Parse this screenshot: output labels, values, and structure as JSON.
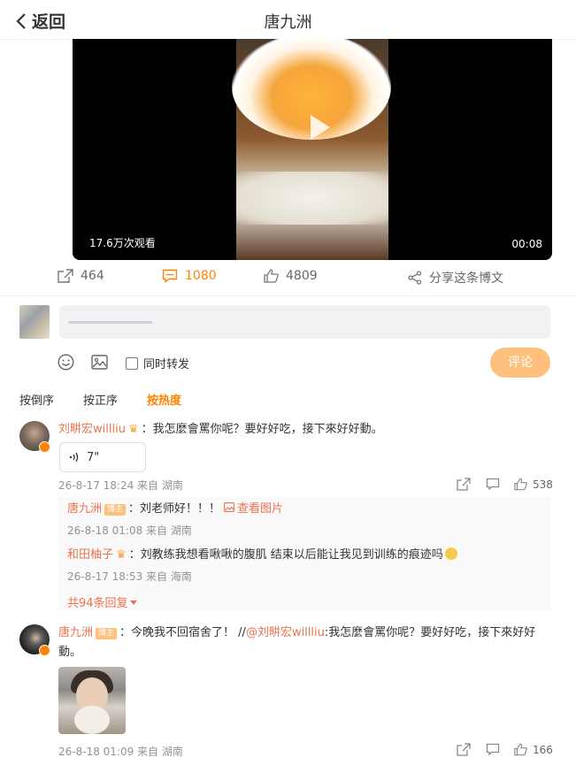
{
  "header": {
    "back_label": "返回",
    "title": "唐九洲"
  },
  "video": {
    "views": "17.6万次观看",
    "duration": "00:08"
  },
  "actions": {
    "repost_count": "464",
    "comment_count": "1080",
    "like_count": "4809",
    "share_label": "分享这条博文"
  },
  "composer": {
    "forward_label": "同时转发",
    "submit_label": "评论"
  },
  "sort_tabs": [
    "按倒序",
    "按正序",
    "按热度"
  ],
  "comments": [
    {
      "user": "刘畊宏willliu",
      "text": "：我怎麼會罵你呢？要好好吃，接下來好好動。",
      "audio_duration": "7\"",
      "time": "26-8-17 18:24 来自 湖南",
      "likes": "538",
      "replies": [
        {
          "user": "唐九洲",
          "tag": "博主",
          "text": "：刘老师好！！！",
          "link": "查看图片",
          "time": "26-8-18 01:08 来自 湖南"
        },
        {
          "user": "和田柚子",
          "text": "：刘教练我想看啾啾的腹肌 结束以后能让我见到训练的痕迹吗",
          "time": "26-8-17 18:53 来自 海南"
        }
      ],
      "more_replies": "共94条回复"
    },
    {
      "user": "唐九洲",
      "tag": "博主",
      "text": "：今晚我不回宿舍了！ //",
      "mention": "@刘畊宏willliu",
      "quote_line1": ":我怎麼會罵你呢？要好好吃，接下來好好",
      "quote_line2": "動。",
      "time": "26-8-18 01:09 来自 湖南",
      "likes": "166"
    }
  ],
  "colors": {
    "accent": "#ff8200",
    "username": "#eb7350",
    "submit_disabled": "#ffc07e"
  }
}
